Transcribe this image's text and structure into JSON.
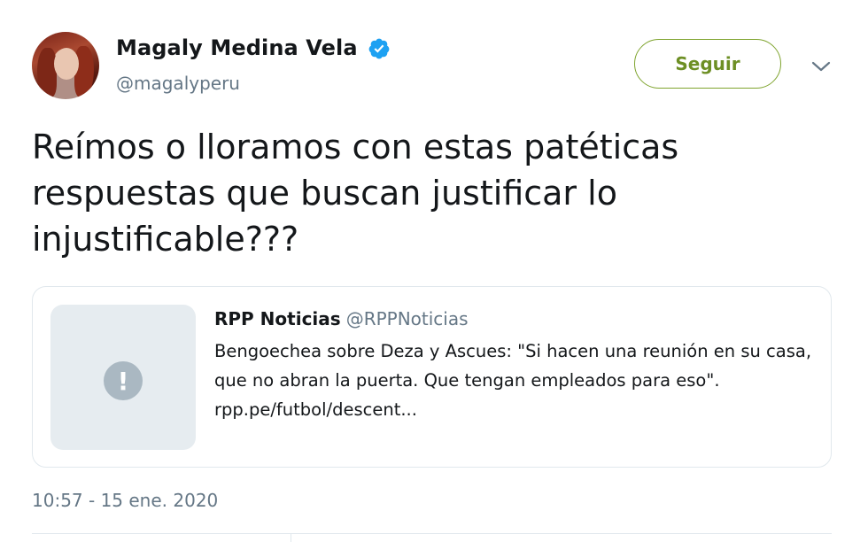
{
  "user": {
    "display_name": "Magaly Medina Vela",
    "handle": "@magalyperu",
    "verified_icon": "verified-badge-icon",
    "avatar_icon": "avatar"
  },
  "actions": {
    "follow_label": "Seguir",
    "more_icon": "chevron-down-icon"
  },
  "tweet": {
    "text": "Reímos o lloramos con estas patéticas respuestas que buscan justificar lo injustificable???",
    "timestamp": "10:57 - 15 ene. 2020"
  },
  "quoted_card": {
    "author_name": "RPP Noticias",
    "author_handle": "@RPPNoticias",
    "body_lines": [
      "Bengoechea sobre Deza y Ascues: \"Si hacen una reunión en su casa,",
      "que no abran la puerta. Que tengan empleados para eso\".",
      "rpp.pe/futbol/descent..."
    ],
    "thumbnail_icon": "warning-icon",
    "thumbnail_glyph": "!"
  },
  "colors": {
    "verified": "#1da1f2",
    "follow_accent": "#7fa42f",
    "secondary_text": "#657786",
    "border": "#e1e8ed"
  }
}
